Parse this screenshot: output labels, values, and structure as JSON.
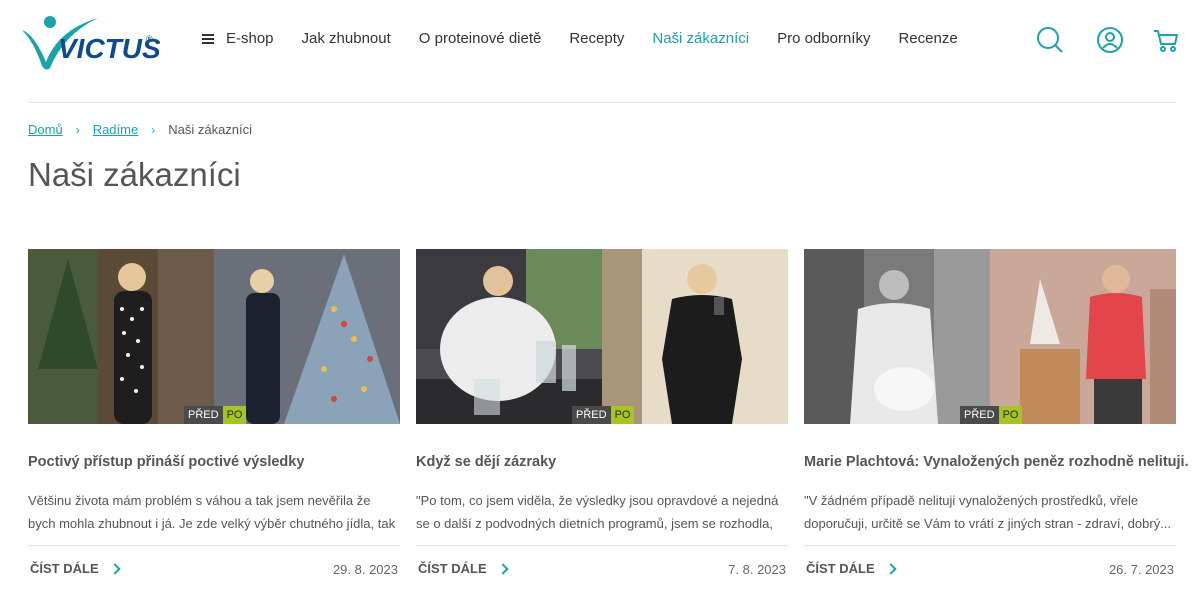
{
  "brand": {
    "logo_text": "VICTUS",
    "trademark": "®",
    "colors": {
      "teal": "#1aa3a8",
      "navy": "#0d4a8f",
      "lime": "#a6c524"
    }
  },
  "nav": {
    "items": [
      {
        "label": "E-shop",
        "icon": "hamburger-icon"
      },
      {
        "label": "Jak zhubnout"
      },
      {
        "label": "O proteinové dietě"
      },
      {
        "label": "Recepty"
      },
      {
        "label": "Naši zákazníci",
        "active": true
      },
      {
        "label": "Pro odborníky"
      },
      {
        "label": "Recenze"
      }
    ],
    "icons": [
      "search-icon",
      "user-icon",
      "cart-icon"
    ]
  },
  "breadcrumb": {
    "home": "Domů",
    "parent": "Radíme",
    "current": "Naši zákazníci"
  },
  "page": {
    "title": "Naši zákazníci"
  },
  "cards": [
    {
      "badge_before": "PŘED",
      "badge_after": "PO",
      "title": "Poctivý přístup přináší poctivé výsledky",
      "excerpt": "Většinu života mám problém s váhou a tak jsem nevěřila že bych mohla zhubnout i já. Je zde velký výběr chutného jídla, tak si...",
      "more_label": "ČÍST DÁLE",
      "date": "29. 8. 2023"
    },
    {
      "badge_before": "PŘED",
      "badge_after": "PO",
      "title": "Když se dějí zázraky",
      "excerpt": "\"Po tom, co jsem viděla, že výsledky jsou opravdové a nejedná se o další z podvodných dietních programů, jsem se rozhodla, že to...",
      "more_label": "ČÍST DÁLE",
      "date": "7. 8. 2023"
    },
    {
      "badge_before": "PŘED",
      "badge_after": "PO",
      "title": "Marie Plachtová: Vynaložených peněz rozhodně nelituji.",
      "excerpt": "\"V žádném případě nelituji vynaložených prostředků, vřele doporučuji, určitě se Vám to vrátí z jiných stran - zdraví, dobrý...",
      "more_label": "ČÍST DÁLE",
      "date": "26. 7. 2023"
    }
  ]
}
